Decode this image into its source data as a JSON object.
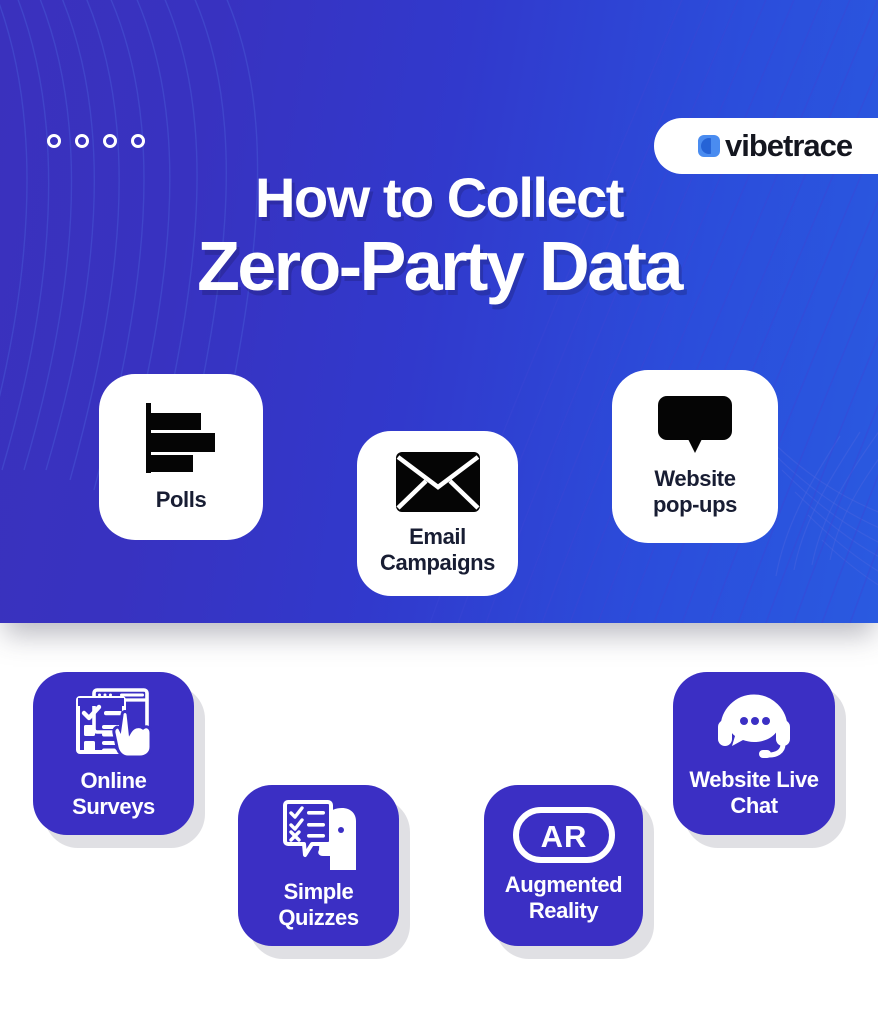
{
  "brand": {
    "name": "vibetrace",
    "logo_icon": "vibetrace-logo-mark",
    "accent_blue": "#4a8cf0"
  },
  "hero": {
    "gradient_from": "#3a31bd",
    "gradient_to": "#2a5ae0",
    "title_line1": "How to Collect",
    "title_line2": "Zero-Party Data",
    "decor_dots_count": 4,
    "cards": [
      {
        "id": "polls",
        "label": "Polls",
        "icon": "bar-chart-icon",
        "bg": "#ffffff",
        "text_color": "#181d33"
      },
      {
        "id": "email",
        "label": "Email\nCampaigns",
        "icon": "envelope-icon",
        "bg": "#ffffff",
        "text_color": "#181d33"
      },
      {
        "id": "popups",
        "label": "Website\npop-ups",
        "icon": "speech-bubble-icon",
        "bg": "#ffffff",
        "text_color": "#181d33"
      }
    ]
  },
  "bottom": {
    "card_bg": "#3b2fc4",
    "card_text_color": "#ffffff",
    "cards": [
      {
        "id": "surveys",
        "label": "Online\nSurveys",
        "icon": "survey-checklist-hand-icon"
      },
      {
        "id": "quizzes",
        "label": "Simple\nQuizzes",
        "icon": "quiz-head-checklist-icon"
      },
      {
        "id": "ar",
        "label": "Augmented\nReality",
        "icon": "ar-badge-icon",
        "icon_text": "AR"
      },
      {
        "id": "chat",
        "label": "Website Live\nChat",
        "icon": "headset-chat-icon"
      }
    ]
  }
}
